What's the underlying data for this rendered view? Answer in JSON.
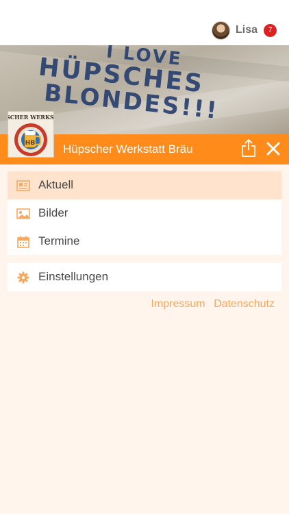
{
  "user": {
    "name": "Lisa",
    "notification_count": "7"
  },
  "banner": {
    "line1": "I LOVE",
    "line2": "HÜPSCHES",
    "line3": "BLONDES!!!"
  },
  "logo": {
    "text": "HÜPSCHER WERKSTATT"
  },
  "header": {
    "title": "Hüpscher Werkstatt Bräu"
  },
  "menu": {
    "items": [
      {
        "label": "Aktuell",
        "icon": "newspaper-icon",
        "active": true
      },
      {
        "label": "Bilder",
        "icon": "image-icon",
        "active": false
      },
      {
        "label": "Termine",
        "icon": "calendar-icon",
        "active": false
      }
    ],
    "settings": {
      "label": "Einstellungen",
      "icon": "gear-icon"
    }
  },
  "footer": {
    "impressum": "Impressum",
    "datenschutz": "Datenschutz"
  },
  "colors": {
    "accent": "#ff8c1a",
    "background": "#fff5ec",
    "active_item": "#ffe3cc",
    "link": "#f5a860",
    "badge": "#e02020"
  }
}
